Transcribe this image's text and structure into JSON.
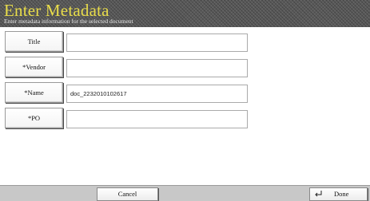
{
  "header": {
    "title": "Enter Metadata",
    "subtitle": "Enter metadata information for the selected document"
  },
  "fields": [
    {
      "label": "Title",
      "value": "",
      "placeholder": ""
    },
    {
      "label": "*Vendor",
      "value": "",
      "placeholder": ""
    },
    {
      "label": "*Name",
      "value": "doc_2232010102617",
      "placeholder": ""
    },
    {
      "label": "*PO",
      "value": "",
      "placeholder": ""
    }
  ],
  "footer": {
    "cancel_label": "Cancel",
    "done_label": "Done",
    "done_icon": "return-arrow-icon"
  },
  "colors": {
    "title_yellow": "#e8dc4a",
    "header_bg": "#5a5a5a",
    "footer_bg": "#c8c8c8"
  }
}
